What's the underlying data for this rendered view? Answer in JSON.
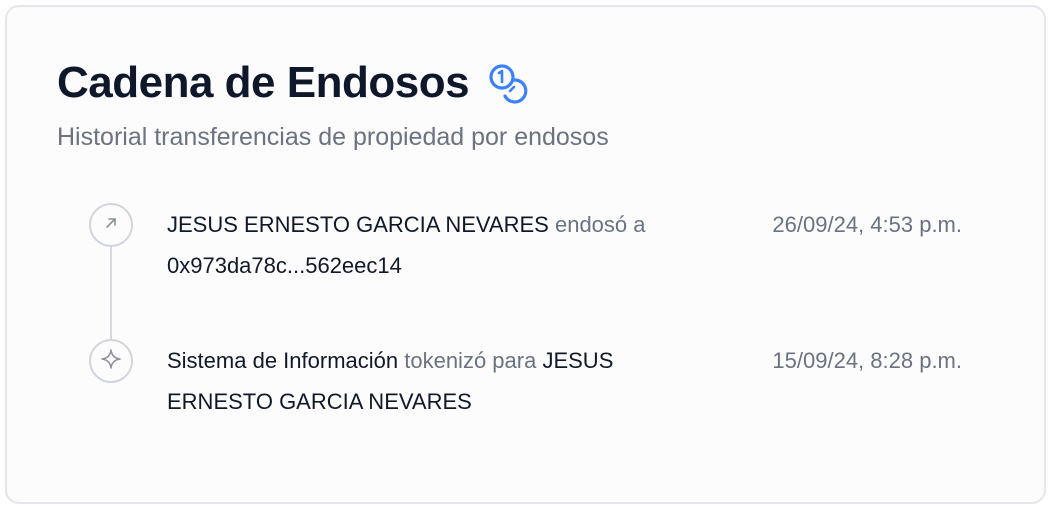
{
  "header": {
    "title": "Cadena de Endosos",
    "title_icon": "coins-icon",
    "subtitle": "Historial transferencias de propiedad por endosos"
  },
  "timeline": [
    {
      "icon": "arrow-up-right-icon",
      "actor": "JESUS ERNESTO GARCIA NEVARES",
      "action": "endosó a",
      "target": "0x973da78c...562eec14",
      "date": "26/09/24, 4:53 p.m."
    },
    {
      "icon": "sparkle-icon",
      "actor": "Sistema de Información",
      "action": "tokenizó para",
      "target": "JESUS ERNESTO GARCIA NEVARES",
      "date": "15/09/24, 8:28 p.m."
    }
  ],
  "colors": {
    "title": "#0f172a",
    "muted": "#6b7280",
    "accent_icon": "#3b82f6",
    "border": "#e4e6ea",
    "node_border": "#d1d5db"
  }
}
